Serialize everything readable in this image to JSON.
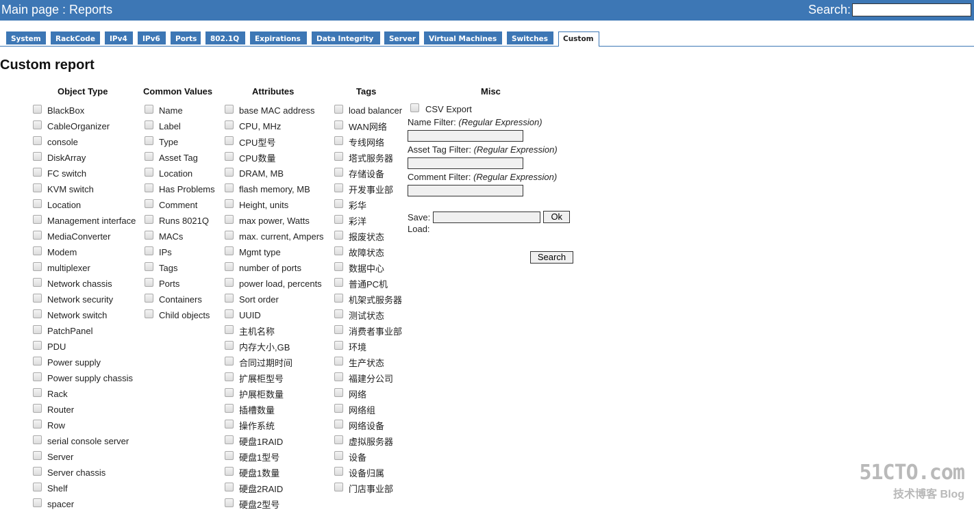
{
  "header": {
    "title": "Main page : Reports",
    "search_label": "Search:",
    "search_value": ""
  },
  "tabs": [
    "System",
    "RackCode",
    "IPv4",
    "IPv6",
    "Ports",
    "802.1Q",
    "Expirations",
    "Data Integrity",
    "Server",
    "Virtual Machines",
    "Switches",
    "Custom"
  ],
  "active_tab": "Custom",
  "page_title": "Custom report",
  "columns": {
    "object_type": {
      "title": "Object Type",
      "items": [
        "BlackBox",
        "CableOrganizer",
        "console",
        "DiskArray",
        "FC switch",
        "KVM switch",
        "Location",
        "Management interface",
        "MediaConverter",
        "Modem",
        "multiplexer",
        "Network chassis",
        "Network security",
        "Network switch",
        "PatchPanel",
        "PDU",
        "Power supply",
        "Power supply chassis",
        "Rack",
        "Router",
        "Row",
        "serial console server",
        "Server",
        "Server chassis",
        "Shelf",
        "spacer"
      ]
    },
    "common_values": {
      "title": "Common Values",
      "items": [
        "Name",
        "Label",
        "Type",
        "Asset Tag",
        "Location",
        "Has Problems",
        "Comment",
        "Runs 8021Q",
        "MACs",
        "IPs",
        "Tags",
        "Ports",
        "Containers",
        "Child objects"
      ]
    },
    "attributes": {
      "title": "Attributes",
      "items": [
        "base MAC address",
        "CPU, MHz",
        "CPU型号",
        "CPU数量",
        "DRAM, MB",
        "flash memory, MB",
        "Height, units",
        "max power, Watts",
        "max. current, Ampers",
        "Mgmt type",
        "number of ports",
        "power load, percents",
        "Sort order",
        "UUID",
        "主机名称",
        "内存大小,GB",
        "合同过期时间",
        "扩展柜型号",
        "护展柜数量",
        "插槽数量",
        "操作系统",
        "硬盘1RAID",
        "硬盘1型号",
        "硬盘1数量",
        "硬盘2RAID",
        "硬盘2型号"
      ]
    },
    "tags": {
      "title": "Tags",
      "items": [
        "load balancer",
        "WAN网络",
        "专线网络",
        "塔式服务器",
        "存储设备",
        "开发事业部",
        "彩华",
        "彩洋",
        "报废状态",
        "故障状态",
        "数据中心",
        "普通PC机",
        "机架式服务器",
        "测试状态",
        "消费者事业部",
        "环境",
        "生产状态",
        "福建分公司",
        "网络",
        "网络组",
        "网络设备",
        "虚拟服务器",
        "设备",
        "设备归属",
        "门店事业部"
      ]
    }
  },
  "misc": {
    "title": "Misc",
    "csv_export": "CSV Export",
    "name_filter": "Name Filter:",
    "asset_tag_filter": "Asset Tag Filter:",
    "comment_filter": "Comment Filter:",
    "regex_hint": "(Regular Expression)",
    "save_label": "Save:",
    "ok_button": "Ok",
    "load_label": "Load:",
    "search_button": "Search"
  },
  "watermark": {
    "line1": "51CTO.com",
    "line2": "技术博客 Blog"
  }
}
